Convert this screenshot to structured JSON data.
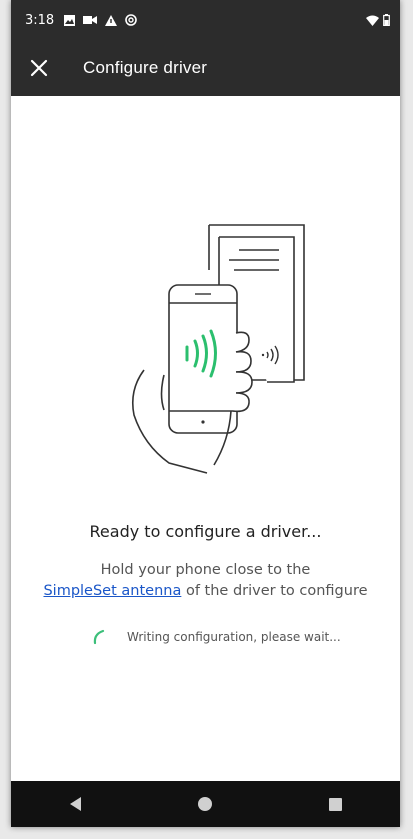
{
  "status_bar": {
    "time": "3:18",
    "left_icons": [
      "image-icon",
      "video-camera-icon",
      "warning-icon",
      "at-sign-icon"
    ],
    "right_icons": [
      "wifi-icon",
      "battery-icon"
    ]
  },
  "app_bar": {
    "title": "Configure driver",
    "close_icon": "close-icon"
  },
  "content": {
    "heading": "Ready to configure a driver...",
    "description_line1": "Hold your phone close to the",
    "link_text": "SimpleSet antenna",
    "description_line2_rest": " of the driver to configure",
    "progress_text": "Writing configuration, please wait..."
  },
  "nav_bar": {
    "back_icon": "back-triangle-icon",
    "home_icon": "home-circle-icon",
    "recents_icon": "recents-square-icon"
  },
  "colors": {
    "app_bar_bg": "#2c2c2c",
    "nfc_wave": "#2bbf6e",
    "link": "#1a56c8",
    "spinner": "#3cbf7a",
    "nav_bar_bg": "#111111"
  }
}
